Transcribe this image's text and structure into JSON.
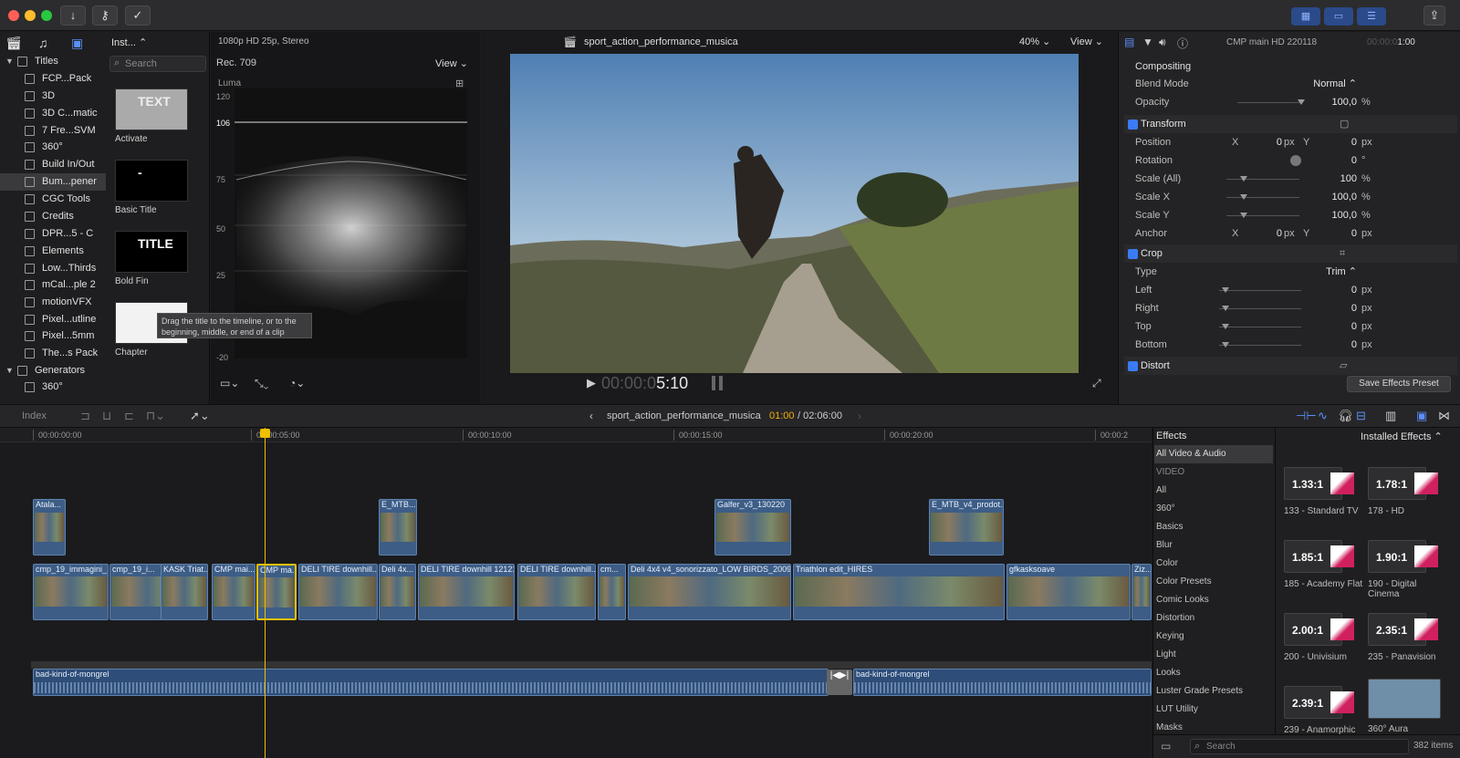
{
  "toolbar": {
    "left_icons": [
      "import-icon",
      "key-icon",
      "check-icon"
    ],
    "right_icons": [
      "browser-layout-icon",
      "timeline-layout-icon",
      "inspector-layout-icon",
      "share-icon"
    ]
  },
  "browser": {
    "dropdown": "Inst...",
    "search_placeholder": "Search",
    "items": [
      {
        "label": "Titles",
        "header": true
      },
      {
        "label": "FCP...Pack"
      },
      {
        "label": "3D"
      },
      {
        "label": "3D C...matic"
      },
      {
        "label": "7 Fre...SVM"
      },
      {
        "label": "360°"
      },
      {
        "label": "Build In/Out"
      },
      {
        "label": "Bum...pener",
        "selected": true
      },
      {
        "label": "CGC Tools"
      },
      {
        "label": "Credits"
      },
      {
        "label": "DPR...5 - C"
      },
      {
        "label": "Elements"
      },
      {
        "label": "Low...Thirds"
      },
      {
        "label": "mCal...ple 2"
      },
      {
        "label": "motionVFX"
      },
      {
        "label": "Pixel...utline"
      },
      {
        "label": "Pixel...5mm"
      },
      {
        "label": "The...s Pack"
      },
      {
        "label": "Generators",
        "header": true
      },
      {
        "label": "360°"
      }
    ],
    "thumbs": [
      {
        "label": "Activate",
        "thumb_text": "TEXT"
      },
      {
        "label": "Basic Title",
        "thumb_text": "-"
      },
      {
        "label": "Bold Fin",
        "thumb_text": "TITLE"
      },
      {
        "label": "Chapter",
        "thumb_text": ""
      }
    ],
    "tooltip": "Drag the title to the timeline, or to the beginning, middle, or end of a clip"
  },
  "scope": {
    "format": "1080p HD 25p, Stereo",
    "colorspace": "Rec. 709",
    "view_label": "View",
    "scope_name": "Luma",
    "y_ticks": [
      "120",
      "106",
      "75",
      "50",
      "25",
      "-20"
    ]
  },
  "viewer": {
    "project_name": "sport_action_performance_musica",
    "zoom": "40%",
    "view_label": "View",
    "timecode_dim": "00:00:0",
    "timecode_bright": "5:10"
  },
  "inspector": {
    "clip_name": "CMP main HD 220118",
    "timecode_dim": "00:00:0",
    "timecode_bright": "1:00",
    "compositing": "Compositing",
    "blend_mode_label": "Blend Mode",
    "blend_mode_value": "Normal ⌃",
    "opacity_label": "Opacity",
    "opacity_value": "100,0",
    "opacity_unit": "%",
    "opacity_level": 1.0,
    "transform": "Transform",
    "position_label": "Position",
    "x_label": "X",
    "y_label": "Y",
    "pos_x": "0",
    "pos_y": "0",
    "px": "px",
    "rotation_label": "Rotation",
    "rotation_value": "0",
    "rotation_unit": "°",
    "scale_all_label": "Scale (All)",
    "scale_all_value": "100",
    "scale_all_unit": "%",
    "scale_x_label": "Scale X",
    "scale_x_value": "100,0",
    "scale_y_label": "Scale Y",
    "scale_y_value": "100,0",
    "anchor_label": "Anchor",
    "anchor_x": "0",
    "anchor_y": "0",
    "crop": "Crop",
    "type_label": "Type",
    "type_value": "Trim ⌃",
    "left_label": "Left",
    "right_label": "Right",
    "top_label": "Top",
    "bottom_label": "Bottom",
    "crop_value": "0",
    "distort": "Distort",
    "save_preset": "Save Effects Preset"
  },
  "timeline_bar": {
    "index_label": "Index",
    "project_name": "sport_action_performance_musica",
    "position": "01:00",
    "duration": "/ 02:06:00"
  },
  "ruler": [
    "00:00:00:00",
    "00:00:05:00",
    "00:00:10:00",
    "00:00:15:00",
    "00:00:20:00",
    "00:00:2"
  ],
  "connected_clips": [
    {
      "name": "Atala..."
    },
    {
      "name": "E_MTB..."
    },
    {
      "name": "Galfer_v3_130220"
    },
    {
      "name": "E_MTB_v4_prodot..."
    }
  ],
  "primary_clips": [
    {
      "name": "cmp_19_immagini_..."
    },
    {
      "name": "cmp_19_i..."
    },
    {
      "name": "KASK Triat..."
    },
    {
      "name": "CMP mai..."
    },
    {
      "name": "CMP ma..."
    },
    {
      "name": "DELI TIRE downhill..."
    },
    {
      "name": "Deli 4x..."
    },
    {
      "name": "DELI TIRE downhill 121217"
    },
    {
      "name": "DELI TIRE downhill..."
    },
    {
      "name": "cm..."
    },
    {
      "name": "Deli 4x4 v4_sonorizzato_LOW BIRDS_2009"
    },
    {
      "name": "Triathlon edit_HIRES"
    },
    {
      "name": "gfkasksoave"
    },
    {
      "name": "Ziz..."
    }
  ],
  "audio_clips": [
    {
      "name": "bad-kind-of-mongrel"
    },
    {
      "name": "bad-kind-of-mongrel"
    }
  ],
  "effects": {
    "title": "Effects",
    "installed": "Installed Effects ⌃",
    "categories": [
      "All Video & Audio",
      "VIDEO",
      "All",
      "360°",
      "Basics",
      "Blur",
      "Color",
      "Color Presets",
      "Comic Looks",
      "Distortion",
      "Keying",
      "Light",
      "Looks",
      "Luster Grade Presets",
      "LUT Utility",
      "Masks"
    ],
    "tiles": [
      {
        "ratio": "1.33:1",
        "label": "133 - Standard TV"
      },
      {
        "ratio": "1.78:1",
        "label": "178 - HD"
      },
      {
        "ratio": "1.85:1",
        "label": "185 - Academy Flat"
      },
      {
        "ratio": "1.90:1",
        "label": "190 - Digital Cinema"
      },
      {
        "ratio": "2.00:1",
        "label": "200 - Univisium"
      },
      {
        "ratio": "2.35:1",
        "label": "235 - Panavision"
      },
      {
        "ratio": "2.39:1",
        "label": "239 - Anamorphic"
      },
      {
        "ratio": "",
        "label": "360° Aura"
      }
    ],
    "search_placeholder": "Search",
    "count": "382 items"
  }
}
